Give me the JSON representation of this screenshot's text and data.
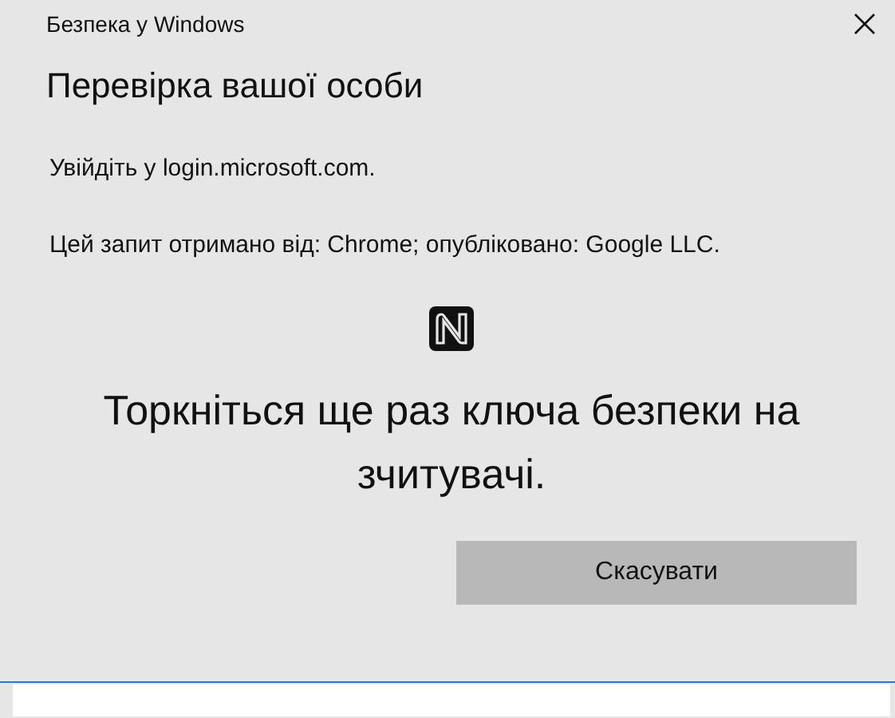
{
  "window": {
    "title": "Безпека у Windows"
  },
  "heading": "Перевірка вашої особи",
  "messages": [
    "Увійдіть у login.microsoft.com.",
    "Цей запит отримано від: Chrome; опубліковано: Google LLC."
  ],
  "prompt": "Торкніться ще раз ключа безпеки на зчитувачі.",
  "buttons": [
    "Скасувати"
  ]
}
